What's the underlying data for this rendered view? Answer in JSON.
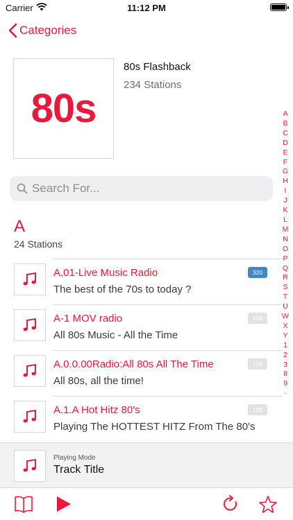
{
  "status": {
    "carrier": "Carrier",
    "time": "11:12 PM"
  },
  "nav": {
    "back_label": "Categories"
  },
  "category": {
    "art_text": "80s",
    "title": "80s Flashback",
    "station_count": "234 Stations"
  },
  "search": {
    "placeholder": "Search For..."
  },
  "index_letters": [
    "A",
    "B",
    "C",
    "D",
    "E",
    "F",
    "G",
    "H",
    "I",
    "J",
    "K",
    "L",
    "M",
    "N",
    "O",
    "P",
    "Q",
    "R",
    "S",
    "T",
    "U",
    "W",
    "X",
    "Y",
    "1",
    "2",
    "3",
    "8",
    "9",
    "·"
  ],
  "section": {
    "letter": "A",
    "count": "24 Stations"
  },
  "stations": [
    {
      "name": "A,01-Live Music Radio",
      "description": "The best of the 70s to today ?",
      "bitrate": "320",
      "badge_style": "blue"
    },
    {
      "name": "A-1 MOV radio",
      "description": "All 80s Music - All the Time",
      "bitrate": "128",
      "badge_style": "gray"
    },
    {
      "name": "A.0.0.00Radio:All 80s All The Time",
      "description": "All 80s, all the time!",
      "bitrate": "128",
      "badge_style": "gray"
    },
    {
      "name": "A.1.A Hot Hitz 80's",
      "description": "Playing The HOTTEST HITZ From The 80's",
      "bitrate": "128",
      "badge_style": "gray"
    }
  ],
  "player": {
    "mode": "Playing Mode",
    "track": "Track Title"
  },
  "toolbar": {
    "icons": [
      "book-icon",
      "play-icon",
      "refresh-icon",
      "star-icon"
    ]
  },
  "colors": {
    "accent": "#e8193c",
    "badge_blue": "#3f89c7",
    "badge_gray": "#e2e2e2"
  }
}
